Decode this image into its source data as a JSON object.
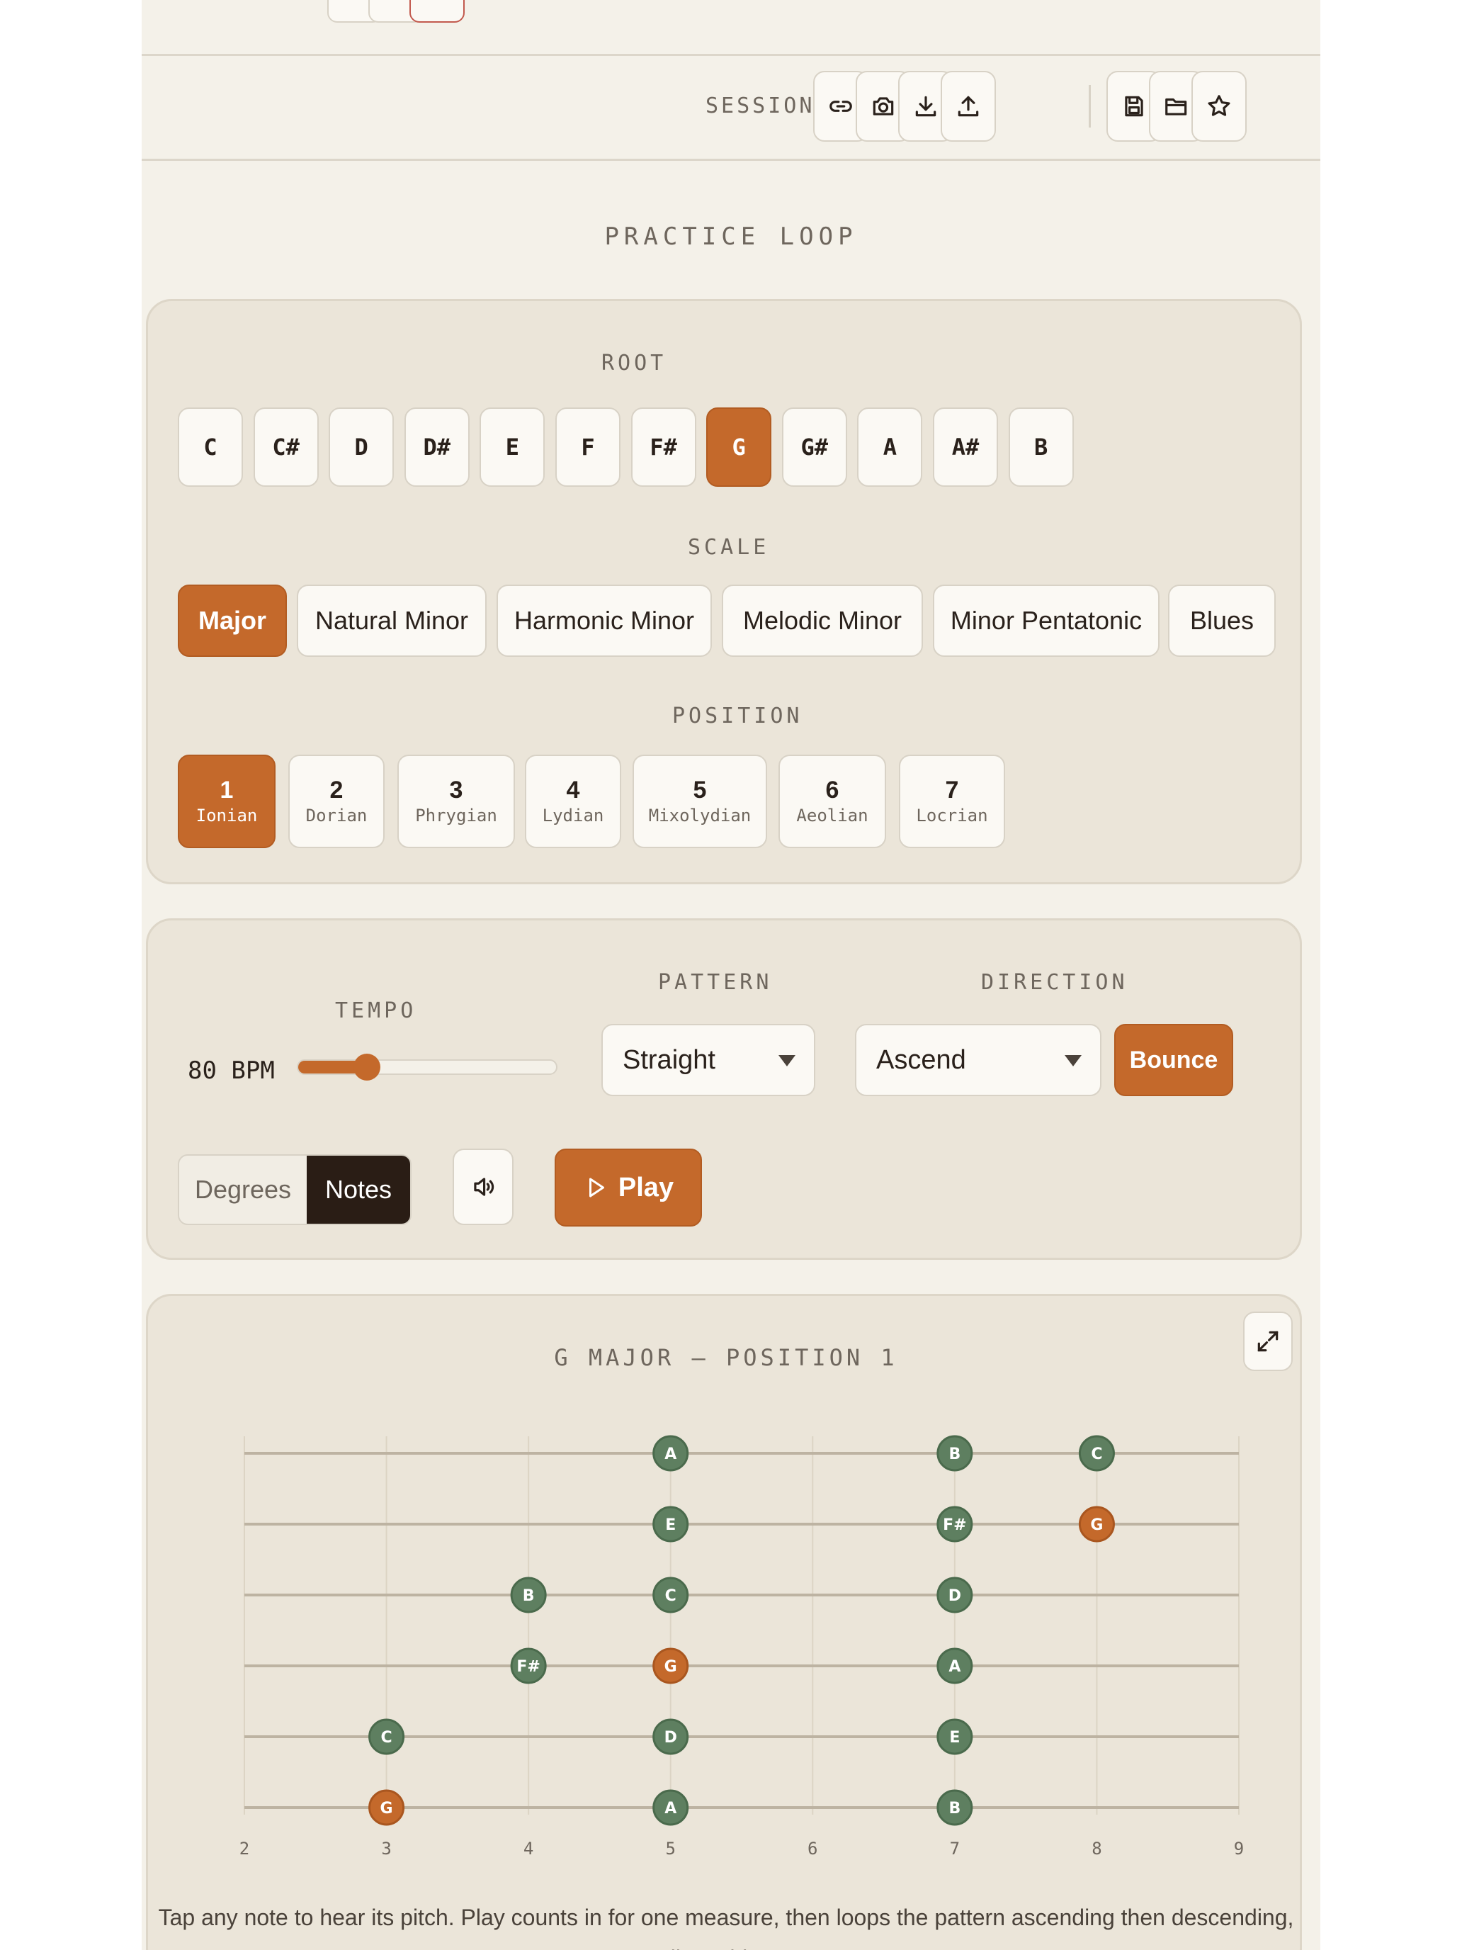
{
  "session": {
    "label": "SESSION",
    "actions": [
      {
        "name": "link-icon"
      },
      {
        "name": "camera-icon"
      },
      {
        "name": "download-icon"
      },
      {
        "name": "upload-icon"
      },
      {
        "name": "save-icon"
      },
      {
        "name": "folder-open-icon"
      },
      {
        "name": "star-icon"
      }
    ]
  },
  "practice": {
    "title": "PRACTICE LOOP"
  },
  "root": {
    "label": "ROOT",
    "notes": [
      "C",
      "C#",
      "D",
      "D#",
      "E",
      "F",
      "F#",
      "G",
      "G#",
      "A",
      "A#",
      "B"
    ],
    "selected": "G"
  },
  "scale": {
    "label": "SCALE",
    "options": [
      "Major",
      "Natural Minor",
      "Harmonic Minor",
      "Melodic Minor",
      "Minor Pentatonic",
      "Blues"
    ],
    "selected": "Major"
  },
  "position": {
    "label": "POSITION",
    "options": [
      {
        "num": "1",
        "mode": "Ionian"
      },
      {
        "num": "2",
        "mode": "Dorian"
      },
      {
        "num": "3",
        "mode": "Phrygian"
      },
      {
        "num": "4",
        "mode": "Lydian"
      },
      {
        "num": "5",
        "mode": "Mixolydian"
      },
      {
        "num": "6",
        "mode": "Aeolian"
      },
      {
        "num": "7",
        "mode": "Locrian"
      }
    ],
    "selected": "1"
  },
  "controls": {
    "tempo_label": "TEMPO",
    "tempo_value": "80 BPM",
    "tempo_fraction": 0.27,
    "pattern_label": "PATTERN",
    "pattern_value": "Straight",
    "direction_label": "DIRECTION",
    "direction_value": "Ascend",
    "bounce_label": "Bounce",
    "toggle": {
      "degrees": "Degrees",
      "notes": "Notes",
      "selected": "Notes"
    },
    "sound_icon": "speaker-icon",
    "play_label": "Play",
    "play_icon": "play-icon"
  },
  "fretboard": {
    "title": "G MAJOR — POSITION 1",
    "expand_icon": "expand-icon",
    "fret_numbers": [
      "2",
      "3",
      "4",
      "5",
      "6",
      "7",
      "8",
      "9"
    ],
    "strings": 6,
    "notes": [
      {
        "string": 1,
        "fret": 5,
        "note": "A",
        "root": false
      },
      {
        "string": 1,
        "fret": 7,
        "note": "B",
        "root": false
      },
      {
        "string": 1,
        "fret": 8,
        "note": "C",
        "root": false
      },
      {
        "string": 2,
        "fret": 5,
        "note": "E",
        "root": false
      },
      {
        "string": 2,
        "fret": 7,
        "note": "F#",
        "root": false
      },
      {
        "string": 2,
        "fret": 8,
        "note": "G",
        "root": true
      },
      {
        "string": 3,
        "fret": 4,
        "note": "B",
        "root": false
      },
      {
        "string": 3,
        "fret": 5,
        "note": "C",
        "root": false
      },
      {
        "string": 3,
        "fret": 7,
        "note": "D",
        "root": false
      },
      {
        "string": 4,
        "fret": 4,
        "note": "F#",
        "root": false
      },
      {
        "string": 4,
        "fret": 5,
        "note": "G",
        "root": true
      },
      {
        "string": 4,
        "fret": 7,
        "note": "A",
        "root": false
      },
      {
        "string": 5,
        "fret": 3,
        "note": "C",
        "root": false
      },
      {
        "string": 5,
        "fret": 5,
        "note": "D",
        "root": false
      },
      {
        "string": 5,
        "fret": 7,
        "note": "E",
        "root": false
      },
      {
        "string": 6,
        "fret": 3,
        "note": "G",
        "root": true
      },
      {
        "string": 6,
        "fret": 5,
        "note": "A",
        "root": false
      },
      {
        "string": 6,
        "fret": 7,
        "note": "B",
        "root": false
      }
    ],
    "footnote": "Tap any note to hear its pitch. Play counts in for one measure, then loops the pattern ascending then descending, until you hit Stop."
  },
  "colors": {
    "accent": "#c4692b",
    "note_green": "#5e7f60",
    "background": "#f4f1e9",
    "panel": "#ebe5d9"
  }
}
